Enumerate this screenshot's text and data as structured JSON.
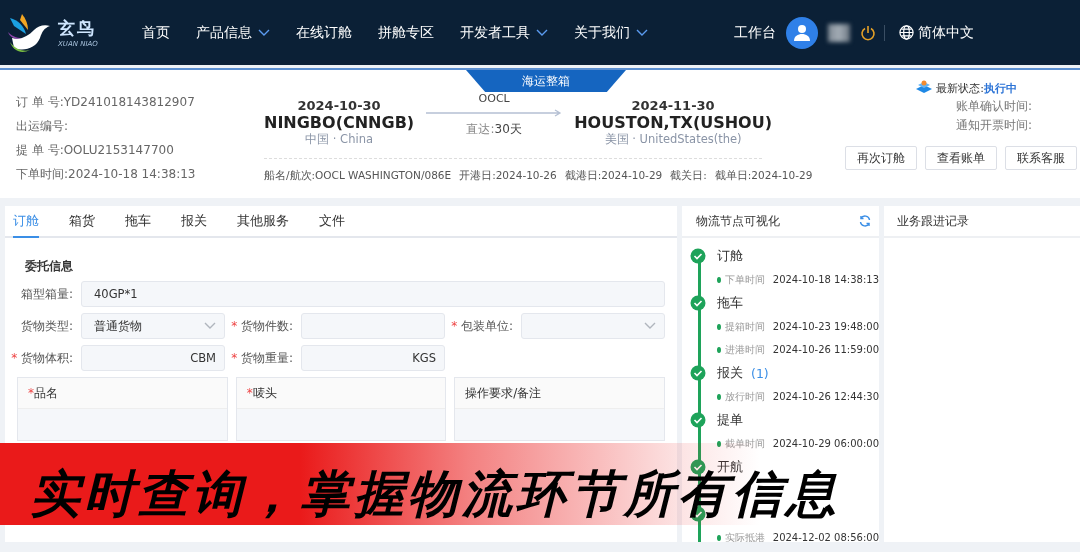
{
  "nav": {
    "brand": "玄鸟",
    "brand_sub": "XUAN NIAO",
    "items": [
      {
        "label": "首页",
        "dropdown": false
      },
      {
        "label": "产品信息",
        "dropdown": true
      },
      {
        "label": "在线订舱",
        "dropdown": false
      },
      {
        "label": "拼舱专区",
        "dropdown": false
      },
      {
        "label": "开发者工具",
        "dropdown": true
      },
      {
        "label": "关于我们",
        "dropdown": true
      }
    ],
    "workbench": "工作台",
    "language": "简体中文"
  },
  "order": {
    "badge": "海运整箱",
    "fields": [
      {
        "label": "订 单 号:",
        "value": "YD241018143812907"
      },
      {
        "label": "出运编号:"
      },
      {
        "label": "提 单 号:",
        "value": "OOLU2153147700"
      },
      {
        "label": "下单时间:",
        "value": "2024-10-18 14:38:13"
      }
    ],
    "departure": {
      "date": "2024-10-30",
      "port": "NINGBO(CNNGB)",
      "country": "中国 · China"
    },
    "carrier": "OOCL",
    "transit_label": "直达:",
    "transit": "30天",
    "arrival": {
      "date": "2024-11-30",
      "port": "HOUSTON,TX(USHOU)",
      "country": "美国 · UnitedStates(the)"
    },
    "vessel_info": [
      {
        "label": "船名/航次:",
        "value": "OOCL WASHINGTON/086E"
      },
      {
        "label": "开港日:",
        "value": "2024-10-26"
      },
      {
        "label": "截港日:",
        "value": "2024-10-29"
      },
      {
        "label": "截关日:"
      },
      {
        "label": "截单日:",
        "value": "2024-10-29"
      }
    ],
    "status": {
      "label": "最新状态:",
      "value": "执行中"
    },
    "status_fields": [
      "账单确认时间:",
      "通知开票时间:"
    ],
    "actions": [
      "再次订舱",
      "查看账单",
      "联系客服"
    ]
  },
  "tabs": [
    {
      "label": "订舱",
      "selected": true
    },
    {
      "label": "箱货",
      "selected": false
    },
    {
      "label": "拖车",
      "selected": false
    },
    {
      "label": "报关",
      "selected": false
    },
    {
      "label": "其他服务",
      "selected": false
    },
    {
      "label": "文件",
      "selected": false
    }
  ],
  "form": {
    "title": "委托信息",
    "rows": [
      [
        {
          "label": "箱型箱量:",
          "kind": "text",
          "value": "40GP*1"
        }
      ],
      [
        {
          "label": "货物类型:",
          "kind": "select",
          "value": "普通货物"
        },
        {
          "label": "货物件数:",
          "kind": "text",
          "marker": "*"
        },
        {
          "label": "包装单位:",
          "kind": "select",
          "marker": "*"
        }
      ],
      [
        {
          "label": "货物体积:",
          "kind": "text",
          "marker": "*",
          "unit": "CBM"
        },
        {
          "label": "货物重量:",
          "kind": "text",
          "marker": "*",
          "unit": "KGS"
        }
      ]
    ],
    "text_areas": [
      {
        "label": "品名",
        "marker": "*"
      },
      {
        "label": "唛头",
        "marker": "*"
      },
      {
        "label": "操作要求/备注"
      }
    ]
  },
  "timeline": {
    "title": "物流节点可视化",
    "nodes": [
      {
        "name": "订舱",
        "done": true,
        "events": [
          {
            "label": "下单时间",
            "time": "2024-10-18 14:38:13"
          }
        ]
      },
      {
        "name": "拖车",
        "done": true,
        "events": [
          {
            "label": "提箱时间",
            "time": "2024-10-23 19:48:00"
          },
          {
            "label": "进港时间",
            "time": "2024-10-26 11:59:00"
          }
        ]
      },
      {
        "name": "报关",
        "count": "(1)",
        "done": true,
        "events": [
          {
            "label": "放行时间",
            "time": "2024-10-26 12:44:30"
          }
        ]
      },
      {
        "name": "提单",
        "done": true,
        "events": [
          {
            "label": "截单时间",
            "time": "2024-10-29 06:00:00"
          }
        ]
      },
      {
        "name": "开航",
        "done": true
      },
      {
        "done": true,
        "events": [
          {
            "label": "实际抵港",
            "time": "2024-12-02 08:56:00"
          }
        ]
      }
    ]
  },
  "records": {
    "title": "业务跟进记录"
  },
  "caption": "实时查询，掌握物流环节所有信息"
}
